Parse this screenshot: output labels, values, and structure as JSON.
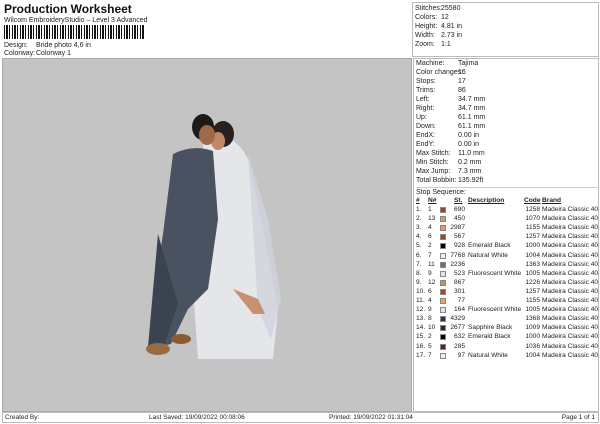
{
  "header": {
    "title": "Production Worksheet",
    "subtitle": "Wilcom EmbroideryStudio – Level 3 Advanced",
    "design_label": "Design:",
    "design": "Bride photo 4,6 in",
    "colorway_label": "Colorway:",
    "colorway": "Colorway 1"
  },
  "summary": [
    {
      "k": "Stitches:",
      "v": "25580"
    },
    {
      "k": "Colors:",
      "v": "12"
    },
    {
      "k": "Height:",
      "v": "4.81 in"
    },
    {
      "k": "Width:",
      "v": "2.73 in"
    },
    {
      "k": "Zoom:",
      "v": "1:1"
    }
  ],
  "details": [
    {
      "k": "Machine:",
      "v": "Tajima"
    },
    {
      "k": "Color changes:",
      "v": "16"
    },
    {
      "k": "Stops:",
      "v": "17"
    },
    {
      "k": "Trims:",
      "v": "86"
    },
    {
      "k": "Left:",
      "v": "34.7 mm"
    },
    {
      "k": "Right:",
      "v": "34.7 mm"
    },
    {
      "k": "Up:",
      "v": "61.1 mm"
    },
    {
      "k": "Down:",
      "v": "61.1 mm"
    },
    {
      "k": "EndX:",
      "v": "0.00 in"
    },
    {
      "k": "EndY:",
      "v": "0.00 in"
    },
    {
      "k": "Max Stitch:",
      "v": "11.0 mm"
    },
    {
      "k": "Min Stitch:",
      "v": "0.2 mm"
    },
    {
      "k": "Max Jump:",
      "v": "7.3 mm"
    },
    {
      "k": "Total Bobbin:",
      "v": "135.92ft"
    }
  ],
  "stop_sequence": {
    "label": "Stop Sequence:",
    "headers": [
      "#",
      "N#",
      "St.",
      "Description",
      "Code",
      "Brand"
    ],
    "rows": [
      [
        "1.",
        "1",
        "#8b4a2b",
        "690",
        "",
        "1258",
        "Madeira Classic 40"
      ],
      [
        "2.",
        "13",
        "#c8a070",
        "450",
        "",
        "1070",
        "Madeira Classic 40"
      ],
      [
        "3.",
        "4",
        "#e8965a",
        "2987",
        "",
        "1155",
        "Madeira Classic 40"
      ],
      [
        "4.",
        "6",
        "#9a4a20",
        "567",
        "",
        "1257",
        "Madeira Classic 40"
      ],
      [
        "5.",
        "2",
        "#000000",
        "928",
        "Emerald Black",
        "1000",
        "Madeira Classic 40"
      ],
      [
        "6.",
        "7",
        "#eeeeee",
        "7768",
        "Natural White",
        "1004",
        "Madeira Classic 40"
      ],
      [
        "7.",
        "11",
        "#6a7080",
        "2236",
        "",
        "1363",
        "Madeira Classic 40"
      ],
      [
        "8.",
        "9",
        "#dde4f4",
        "523",
        "Fluorescent White",
        "1005",
        "Madeira Classic 40"
      ],
      [
        "9.",
        "12",
        "#d08858",
        "867",
        "",
        "1226",
        "Madeira Classic 40"
      ],
      [
        "10.",
        "6",
        "#a04a20",
        "301",
        "",
        "1257",
        "Madeira Classic 40"
      ],
      [
        "11.",
        "4",
        "#f0a060",
        "77",
        "",
        "1155",
        "Madeira Classic 40"
      ],
      [
        "12.",
        "9",
        "#dde4f4",
        "164",
        "Fluorescent White",
        "1005",
        "Madeira Classic 40"
      ],
      [
        "13.",
        "8",
        "#2a3550",
        "4329",
        "",
        "1368",
        "Madeira Classic 40"
      ],
      [
        "14.",
        "10",
        "#2a2a30",
        "2677",
        "Sapphire Black",
        "1009",
        "Madeira Classic 40"
      ],
      [
        "15.",
        "2",
        "#000000",
        "632",
        "Emerald Black",
        "1000",
        "Madeira Classic 40"
      ],
      [
        "16.",
        "5",
        "#5a2020",
        "285",
        "",
        "1036",
        "Madeira Classic 40"
      ],
      [
        "17.",
        "7",
        "#eeeeee",
        "97",
        "Natural White",
        "1004",
        "Madeira Classic 40"
      ]
    ]
  },
  "footer": {
    "created": "Created By:",
    "saved": "Last Saved: 19/09/2022 00:08:06",
    "printed": "Printed: 19/09/2022 01:31:04",
    "page": "Page 1 of 1"
  }
}
